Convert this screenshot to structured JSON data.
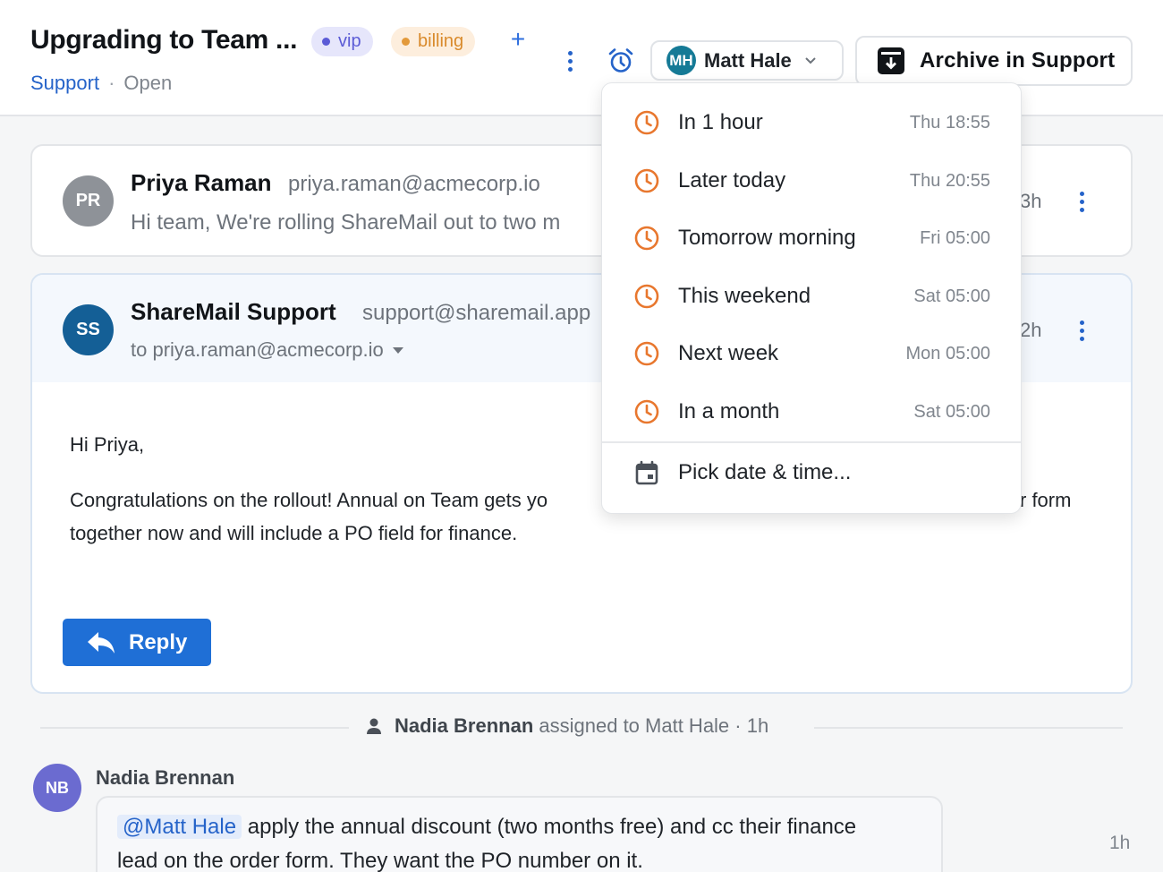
{
  "header": {
    "title": "Upgrading to Team ...",
    "tags": [
      {
        "label": "vip",
        "color": "#5b5bd6"
      },
      {
        "label": "billing",
        "color": "#d98a2b"
      }
    ],
    "add_tag": "+",
    "breadcrumb": {
      "mailbox": "Support",
      "separator": "·",
      "status": "Open"
    },
    "assignee": {
      "initials": "MH",
      "name": "Matt Hale"
    },
    "archive_label": "Archive in Support"
  },
  "messages": [
    {
      "initials": "PR",
      "sender": "Priya Raman",
      "email": "priya.raman@acmecorp.io",
      "snippet": "Hi team, We're rolling ShareMail out to two m",
      "time": "3h"
    },
    {
      "initials": "SS",
      "sender": "ShareMail Support",
      "email": "support@sharemail.app",
      "to": "to priya.raman@acmecorp.io",
      "time": "2h",
      "greeting": "Hi Priya,",
      "body_line1_a": "Congratulations on the rollout! Annual on Team gets yo",
      "body_line1_b": "r form",
      "body_line2": "together now and will include a PO field for finance.",
      "reply_label": "Reply"
    }
  ],
  "activity": {
    "who": "Nadia Brennan",
    "text": "assigned to Matt Hale · 1h"
  },
  "note": {
    "initials": "NB",
    "author": "Nadia Brennan",
    "mention": "@Matt Hale",
    "text_line1": " apply the annual discount (two months free) and cc their finance",
    "text_line2": "lead on the order form. They want the PO number on it.",
    "time": "1h"
  },
  "snooze_menu": {
    "items": [
      {
        "label": "In 1 hour",
        "time": "Thu 18:55"
      },
      {
        "label": "Later today",
        "time": "Thu 20:55"
      },
      {
        "label": "Tomorrow morning",
        "time": "Fri 05:00"
      },
      {
        "label": "This weekend",
        "time": "Sat 05:00"
      },
      {
        "label": "Next week",
        "time": "Mon 05:00"
      },
      {
        "label": "In a month",
        "time": "Sat 05:00"
      }
    ],
    "custom_label": "Pick date & time..."
  },
  "colors": {
    "accent": "#2563c9",
    "snooze_icon": "#e8772e",
    "reply_button": "#1f6fd6"
  }
}
